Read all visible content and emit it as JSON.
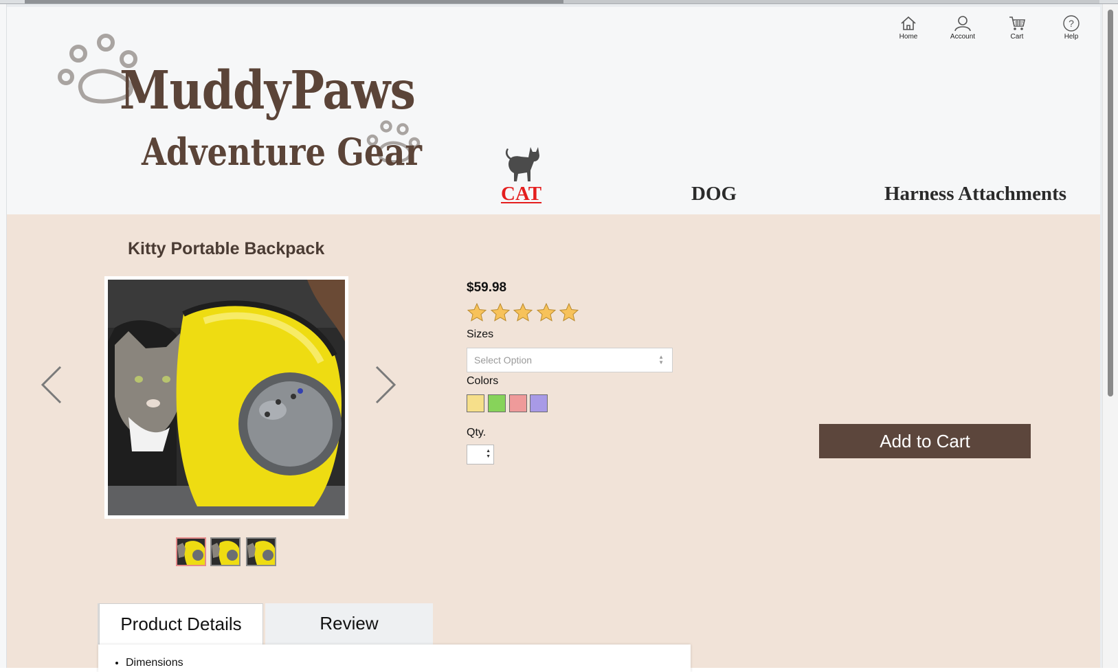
{
  "brand": {
    "name": "MuddyPaws",
    "tagline": "Adventure Gear"
  },
  "top_nav": [
    {
      "label": "Home",
      "icon": "home-icon"
    },
    {
      "label": "Account",
      "icon": "account-icon"
    },
    {
      "label": "Cart",
      "icon": "cart-icon"
    },
    {
      "label": "Help",
      "icon": "help-icon"
    }
  ],
  "categories": [
    {
      "label": "CAT",
      "active": true,
      "icon": "cat-icon"
    },
    {
      "label": "DOG",
      "active": false
    },
    {
      "label": "Harness Attachments",
      "active": false
    }
  ],
  "product": {
    "title": "Kitty Portable Backpack",
    "price": "$59.98",
    "rating": 5,
    "rating_max": 5,
    "sizes_label": "Sizes",
    "sizes_placeholder": "Select Option",
    "colors_label": "Colors",
    "colors": [
      "#f6df8a",
      "#87d35a",
      "#ef9a9a",
      "#a89ae6"
    ],
    "qty_label": "Qty.",
    "qty_value": "",
    "add_to_cart_label": "Add to Cart",
    "thumbnail_count": 3,
    "selected_thumbnail": 1
  },
  "tabs": [
    {
      "label": "Product Details",
      "active": true
    },
    {
      "label": "Review",
      "active": false
    }
  ],
  "details": {
    "items": [
      "Dimensions"
    ]
  },
  "theme": {
    "brand_brown": "#5c463c",
    "active_red": "#e41e1e",
    "content_bg": "#f1e3d8",
    "header_bg": "#f6f7f8",
    "star_color": "#f7c25a"
  }
}
